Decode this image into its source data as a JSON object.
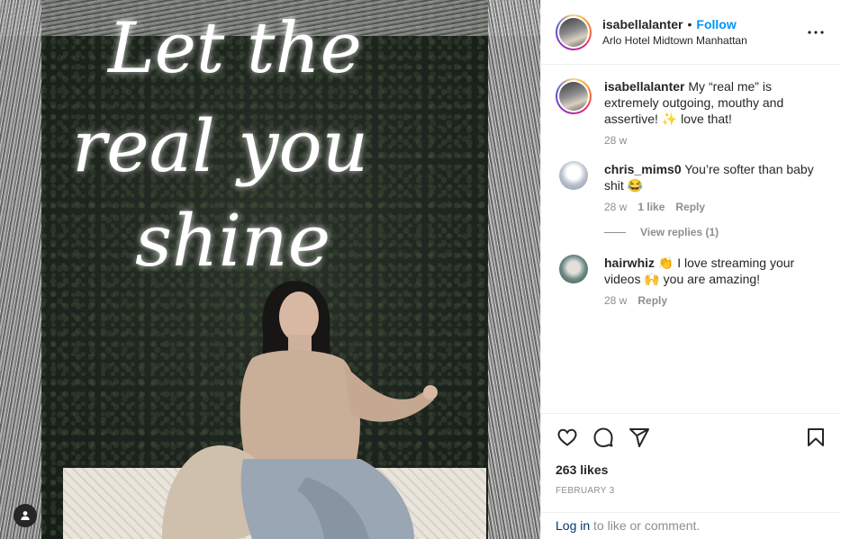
{
  "post": {
    "photo": {
      "neon_text": [
        "Let the",
        "real you",
        "shine"
      ]
    },
    "author": {
      "username": "isabellalanter",
      "separator": "•",
      "follow_label": "Follow",
      "location": "Arlo Hotel Midtown Manhattan"
    },
    "caption": {
      "username": "isabellalanter",
      "text": "My “real me” is extremely outgoing, mouthy and assertive! ✨ love that!",
      "time": "28 w"
    },
    "comments": [
      {
        "username": "chris_mims0",
        "text": "You’re softer than baby shit 😂",
        "time": "28 w",
        "likes": "1 like",
        "reply": "Reply",
        "view_replies": "View replies (1)"
      },
      {
        "username": "hairwhiz",
        "text": "👏 I love streaming your videos 🙌 you are amazing!",
        "time": "28 w",
        "reply": "Reply"
      }
    ],
    "likes": "263 likes",
    "date": "FEBRUARY 3",
    "login_prompt": {
      "link": "Log in",
      "rest": " to like or comment."
    },
    "icons": {
      "more": "more-options-icon",
      "like": "heart-icon",
      "comment": "comment-bubble-icon",
      "share": "paper-plane-icon",
      "save": "bookmark-icon",
      "tagged": "user-tag-icon"
    },
    "colors": {
      "follow": "#0095f6",
      "muted": "#8e8e8e",
      "text": "#262626",
      "link": "#00376b"
    }
  }
}
